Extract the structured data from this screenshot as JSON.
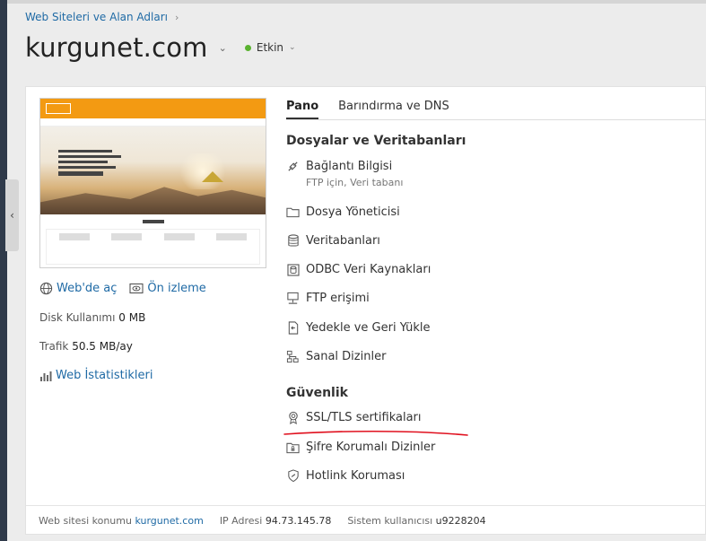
{
  "breadcrumb": {
    "label": "Web Siteleri ve Alan Adları",
    "sep": "›"
  },
  "site": {
    "title": "kurgunet.com",
    "status": "Etkin"
  },
  "preview": {
    "open_web": "Web'de aç",
    "preview": "Ön izleme"
  },
  "disk": {
    "label": "Disk Kullanımı",
    "value": "0 MB"
  },
  "traffic": {
    "label": "Trafik",
    "value": "50.5 MB/ay"
  },
  "web_stats": "Web İstatistikleri",
  "tabs": [
    {
      "label": "Pano",
      "active": true
    },
    {
      "label": "Barındırma ve DNS",
      "active": false
    }
  ],
  "sections": {
    "files": {
      "title": "Dosyalar ve Veritabanları",
      "items": [
        {
          "label": "Bağlantı Bilgisi",
          "sub": "FTP için, Veri tabanı",
          "icon": "connection-icon"
        },
        {
          "label": "Dosya Yöneticisi",
          "icon": "folder-icon"
        },
        {
          "label": "Veritabanları",
          "icon": "database-icon"
        },
        {
          "label": "ODBC Veri Kaynakları",
          "icon": "odbc-icon"
        },
        {
          "label": "FTP erişimi",
          "icon": "ftp-icon"
        },
        {
          "label": "Yedekle ve Geri Yükle",
          "icon": "backup-icon"
        },
        {
          "label": "Sanal Dizinler",
          "icon": "sitemap-icon"
        }
      ]
    },
    "security": {
      "title": "Güvenlik",
      "items": [
        {
          "label": "SSL/TLS sertifikaları",
          "icon": "certificate-icon"
        },
        {
          "label": "Şifre Korumalı Dizinler",
          "icon": "locked-folder-icon"
        },
        {
          "label": "Hotlink Koruması",
          "icon": "shield-link-icon"
        }
      ]
    }
  },
  "footer": {
    "location_label": "Web sitesi konumu",
    "location_value": "kurgunet.com",
    "ip_label": "IP Adresi",
    "ip_value": "94.73.145.78",
    "user_label": "Sistem kullanıcısı",
    "user_value": "u9228204"
  },
  "colors": {
    "link": "#1f6aa5",
    "status_dot": "#5ab230",
    "annotation": "#e0101e"
  }
}
